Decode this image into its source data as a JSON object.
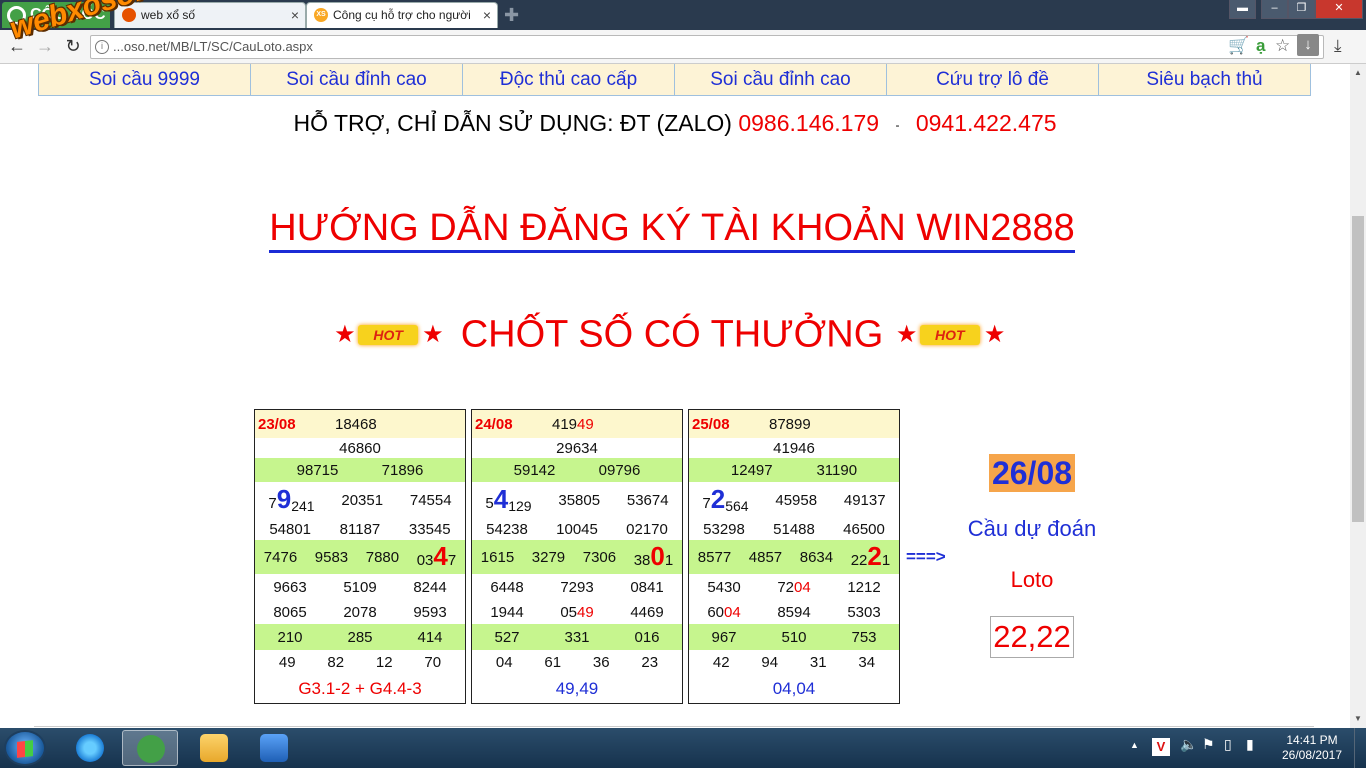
{
  "browser": {
    "brand": "CỐC CỐC",
    "tabs": [
      {
        "title": "web xổ số"
      },
      {
        "title": "Công cụ hỗ trợ cho người",
        "favicon_text": "XS"
      }
    ],
    "url": "...oso.net/MB/LT/SC/CauLoto.aspx",
    "watermark": "webxoso.net"
  },
  "menu": [
    "Soi cầu 9999",
    "Soi cầu đỉnh cao",
    "Độc thủ cao cấp",
    "Soi cầu đỉnh cao",
    "Cứu trợ lô đề",
    "Siêu bạch thủ"
  ],
  "support": {
    "label": "HỖ TRỢ, CHỈ DẪN SỬ DỤNG: ĐT (ZALO)",
    "phone1": "0986.146.179",
    "separator": "-",
    "phone2": "0941.422.475"
  },
  "register_title": "HƯỚNG DẪN ĐĂNG KÝ TÀI KHOẢN WIN2888",
  "promo": {
    "text": "CHỐT SỐ CÓ THƯỞNG",
    "badge": "HOT"
  },
  "boxes": [
    {
      "date": "23/08",
      "head": [
        "18468",
        ""
      ],
      "r1": "46860",
      "r2": [
        "98715",
        "71896"
      ],
      "r3": [
        {
          "pre": "7",
          "big": "9",
          "post": "241"
        },
        "20351",
        "74554"
      ],
      "r4": [
        "54801",
        "81187",
        "33545"
      ],
      "r5": [
        "7476",
        "9583",
        "7880",
        {
          "pre": "03",
          "big": "4",
          "post": "7"
        }
      ],
      "r6": [
        "9663",
        "5109",
        "8244"
      ],
      "r7": [
        "8065",
        "2078",
        "9593"
      ],
      "r8": [
        "210",
        "285",
        "414"
      ],
      "r9": [
        "49",
        "82",
        "12",
        "70"
      ],
      "result": "G3.1-2 + G4.4-3"
    },
    {
      "date": "24/08",
      "head": [
        "419",
        "49"
      ],
      "r1": "29634",
      "r2": [
        "59142",
        "09796"
      ],
      "r3": [
        {
          "pre": "5",
          "big": "4",
          "post": "129"
        },
        "35805",
        "53674"
      ],
      "r4": [
        "54238",
        "10045",
        "02170"
      ],
      "r5": [
        "1615",
        "3279",
        "7306",
        {
          "pre": "38",
          "big": "0",
          "post": "1"
        }
      ],
      "r6": [
        "6448",
        "7293",
        "0841"
      ],
      "r7": [
        "1944",
        {
          "pre": "05",
          "red": "49"
        },
        "4469"
      ],
      "r8": [
        "527",
        "331",
        "016"
      ],
      "r9": [
        "04",
        "61",
        "36",
        "23"
      ],
      "result": "49,49"
    },
    {
      "date": "25/08",
      "head": [
        "87899",
        ""
      ],
      "r1": "41946",
      "r2": [
        "12497",
        "31190"
      ],
      "r3": [
        {
          "pre": "7",
          "big": "2",
          "post": "564"
        },
        "45958",
        "49137"
      ],
      "r4": [
        "53298",
        "51488",
        "46500"
      ],
      "r5": [
        "8577",
        "4857",
        "8634",
        {
          "pre": "22",
          "big": "2",
          "post": "1"
        }
      ],
      "r6": [
        "5430",
        {
          "pre": "72",
          "red": "04"
        },
        "1212"
      ],
      "r7": [
        {
          "pre": "60",
          "red": "04"
        },
        "8594",
        "5303"
      ],
      "r8": [
        "967",
        "510",
        "753"
      ],
      "r9": [
        "42",
        "94",
        "31",
        "34"
      ],
      "result": "04,04"
    }
  ],
  "arrow": "===>",
  "prediction": {
    "date": "26/08",
    "label": "Cầu dự đoán",
    "type": "Loto",
    "value": "22,22"
  },
  "taskbar": {
    "time": "14:41 PM",
    "date": "26/08/2017",
    "tray_badge": "V"
  },
  "colors": {
    "red": "#ee0000",
    "blue": "#1f2fd6",
    "green_row": "#c6f58e",
    "header_row": "#fdf7cd"
  }
}
